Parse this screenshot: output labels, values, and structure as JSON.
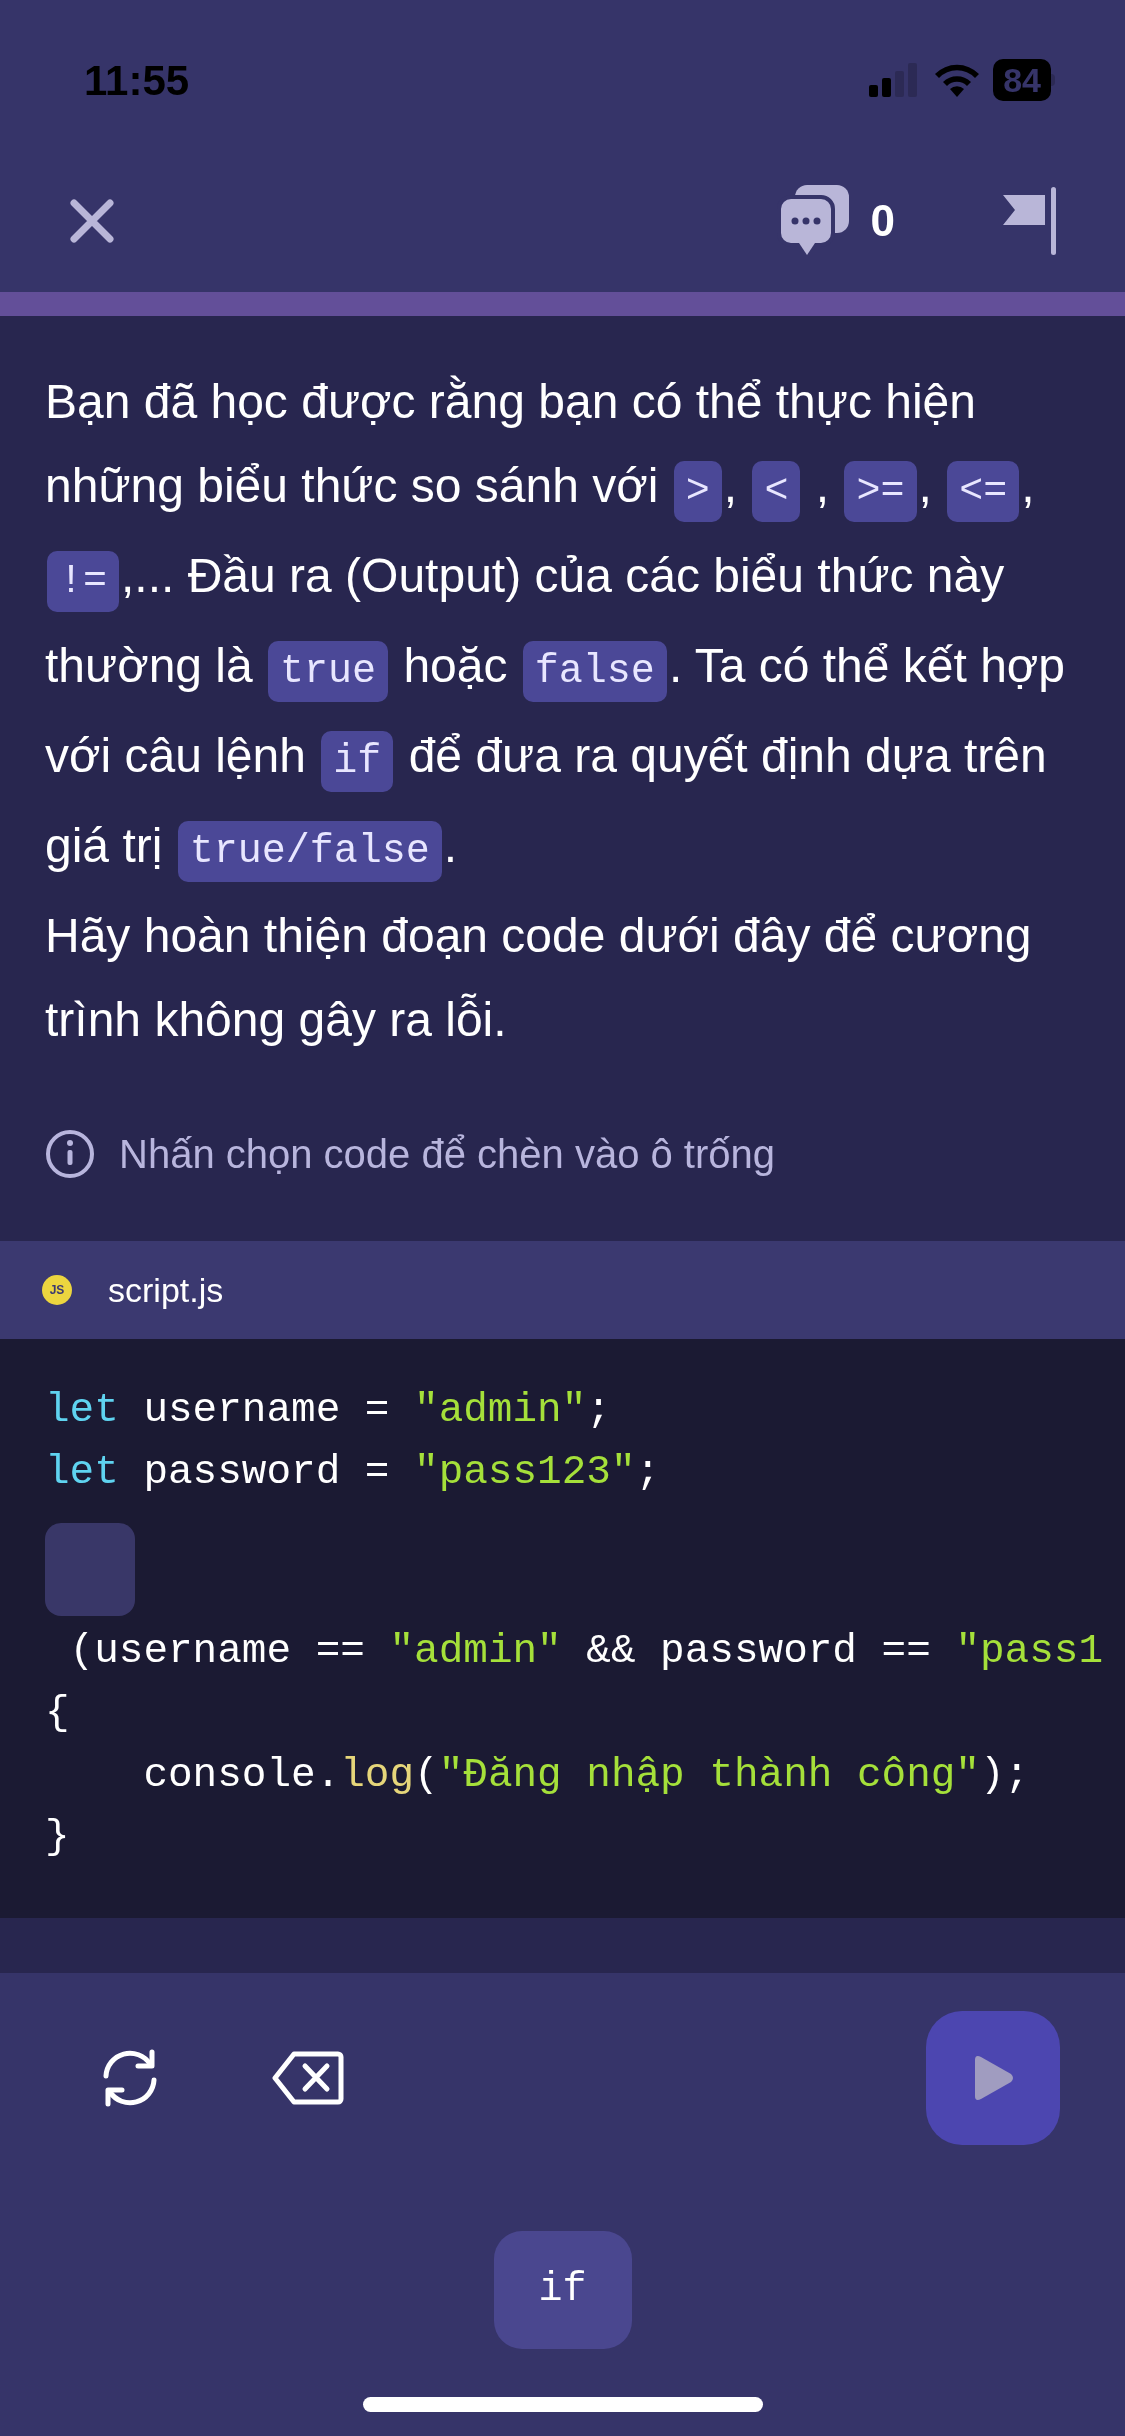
{
  "status_bar": {
    "time": "11:55",
    "battery": "84"
  },
  "nav": {
    "comment_count": "0"
  },
  "instructions": [
    [
      {
        "kind": "text",
        "text": "Bạn đã học được rằng bạn có thể thực hiện những biểu thức so sánh với "
      },
      {
        "kind": "code",
        "text": ">"
      },
      {
        "kind": "text",
        "text": ", "
      },
      {
        "kind": "code",
        "text": "<"
      },
      {
        "kind": "text",
        "text": " , "
      },
      {
        "kind": "code",
        "text": ">="
      },
      {
        "kind": "text",
        "text": ", "
      },
      {
        "kind": "code",
        "text": "<="
      },
      {
        "kind": "text",
        "text": ", "
      },
      {
        "kind": "code",
        "text": "!="
      },
      {
        "kind": "text",
        "text": ",... Đầu ra (Output) của các biểu thức này thường là "
      },
      {
        "kind": "code",
        "text": "true"
      },
      {
        "kind": "text",
        "text": " hoặc "
      },
      {
        "kind": "code",
        "text": "false"
      },
      {
        "kind": "text",
        "text": ". Ta có thể kết hợp với câu lệnh "
      },
      {
        "kind": "code",
        "text": "if"
      },
      {
        "kind": "text",
        "text": " để đưa ra quyết định dựa trên giá trị "
      },
      {
        "kind": "code",
        "text": "true/false"
      },
      {
        "kind": "text",
        "text": "."
      }
    ],
    [
      {
        "kind": "text",
        "text": "Hãy hoàn thiện đoạn code dưới đây để cương trình không gây ra lỗi."
      }
    ]
  ],
  "hint": "Nhấn chọn code để chèn vào ô trống",
  "file_tab": {
    "badge": "JS",
    "name": "script.js"
  },
  "code_lines": [
    {
      "kind": "code",
      "tokens": [
        {
          "kind": "keyword",
          "text": "let"
        },
        {
          "kind": "plain",
          "text": " username = "
        },
        {
          "kind": "string",
          "text": "\"admin\""
        },
        {
          "kind": "plain",
          "text": ";"
        }
      ]
    },
    {
      "kind": "code",
      "tokens": [
        {
          "kind": "keyword",
          "text": "let"
        },
        {
          "kind": "plain",
          "text": " password = "
        },
        {
          "kind": "string",
          "text": "\"pass123\""
        },
        {
          "kind": "plain",
          "text": ";"
        }
      ]
    },
    {
      "kind": "blank"
    },
    {
      "kind": "code",
      "tokens": [
        {
          "kind": "plain",
          "text": " (username == "
        },
        {
          "kind": "string",
          "text": "\"admin\""
        },
        {
          "kind": "plain",
          "text": " && password == "
        },
        {
          "kind": "string",
          "text": "\"pass1"
        }
      ]
    },
    {
      "kind": "code",
      "tokens": [
        {
          "kind": "plain",
          "text": "{"
        }
      ]
    },
    {
      "kind": "code",
      "tokens": [
        {
          "kind": "plain",
          "text": "    console."
        },
        {
          "kind": "function",
          "text": "log"
        },
        {
          "kind": "plain",
          "text": "("
        },
        {
          "kind": "string",
          "text": "\"Đăng nhập thành công\""
        },
        {
          "kind": "plain",
          "text": ");"
        }
      ]
    },
    {
      "kind": "code",
      "tokens": [
        {
          "kind": "plain",
          "text": "}"
        }
      ]
    }
  ],
  "run_button": {
    "disabled": true
  },
  "choices": [
    {
      "text": "if"
    }
  ]
}
